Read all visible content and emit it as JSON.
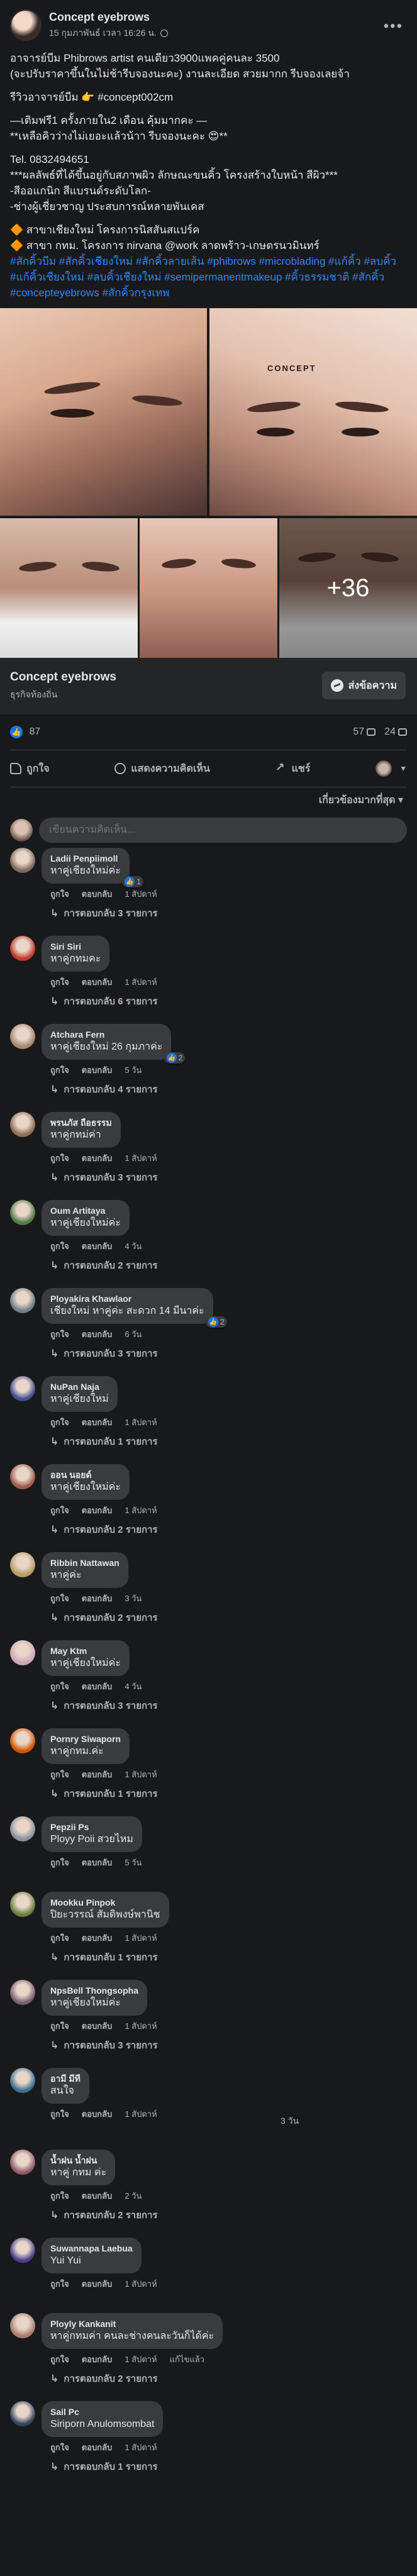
{
  "post": {
    "page_name": "Concept eyebrows",
    "time": "15 กุมภาพันธ์ เวลา 16:26 น.",
    "more": "•••",
    "lines": [
      "อาจารย์บีม Phibrows artist คนเดียว3900แพคคู่คนละ 3500",
      "(จะปรับราคาขึ้นในไม่ช้ารีบจองนะคะ)  งานละเอียด สวยมากก รีบจองเลยจ้า",
      "",
      "รีวิวอาจารย์บีม 👉 #concept002cm",
      "",
      "—เติมฟรี1 ครั้งภายใน2 เดือน คุ้มมากคะ —",
      "**เหลือคิวว่างไม่เยอะแล้วน้าา  รีบจองนะคะ 😍**",
      "",
      "  Tel. 0832494651",
      "***ผลลัพธ์ที่ได้ขึ้นอยู่กับสภาพผิว ลักษณะขนคิ้ว โครงสร้างใบหน้า สีผิว***",
      "-สีออแกนิก สีแบรนด์ระดับโลก-",
      "-ช่างผู้เชี่ยวชาญ ประสบการณ์หลายพันเคส",
      "",
      "🔶 สาขาเชียงใหม่  โครงการนิสสันสแปร์ค",
      "🔶 สาขา กทม.  โครงการ nirvana @work ลาดพร้าว-เกษตรนวมินทร์"
    ],
    "hashtags": "#สักคิ้วบีม #สักคิ้วเชียงใหม่ #สักคิ้วลายเส้น #phibrows #microblading #แก้คิ้ว #ลบคิ้ว #แก้คิ้วเชียงใหม่ #ลบคิ้วเชียงใหม่ #semipermanentmakeup #คิ้วธรรมชาติ #สักคิ้ว #concepteyebrows #สักคิ้วกรุงเทพ",
    "gallery": {
      "watermark": "CONCEPT",
      "more_count": "+36"
    }
  },
  "page_bar": {
    "name": "Concept eyebrows",
    "category": "ธุรกิจท้องถิ่น",
    "message_label": "ส่งข้อความ"
  },
  "reactions": {
    "likes": "87",
    "comments": "57",
    "shares": "24"
  },
  "actions": {
    "like": "ถูกใจ",
    "comment": "แสดงความคิดเห็น",
    "share": "แชร์"
  },
  "sort": {
    "label": "เกี่ยวข้องมากที่สุด ▾"
  },
  "compose": {
    "placeholder": "เขียนความคิดเห็น..."
  },
  "labels": {
    "like": "ถูกใจ",
    "reply": "ตอบกลับ"
  },
  "comments": [
    {
      "name": "Ladii Penpiimoll",
      "text": "หาคู่เชียงใหม่ค่ะ",
      "time": "1 สัปดาห์",
      "replies": "การตอบกลับ 3 รายการ",
      "badge": "1",
      "color": "#7d6a5e"
    },
    {
      "name": "Siri Siri",
      "text": "หาคู่กทมคะ",
      "time": "1 สัปดาห์",
      "replies": "การตอบกลับ 6 รายการ",
      "badge": "",
      "color": "#c0392b"
    },
    {
      "name": "Atchara Fern",
      "text": "หาคู่เชียงใหม่ 26 กุมภาค่ะ",
      "time": "5 วัน",
      "replies": "การตอบกลับ 4 รายการ",
      "badge": "2",
      "color": "#a3876f"
    },
    {
      "name": "พรนภัส ถือธรรม",
      "text": "หาคู่กทม่ค่า",
      "time": "1 สัปดาห์",
      "replies": "การตอบกลับ 3 รายการ",
      "badge": "",
      "color": "#8e6d56"
    },
    {
      "name": "Oum Artitaya",
      "text": "หาคู่เชียงใหม่ค่ะ",
      "time": "4 วัน",
      "replies": "การตอบกลับ 2 รายการ",
      "badge": "",
      "color": "#4f7a45"
    },
    {
      "name": "Ployakira Khawlaor",
      "text": "เชียงใหม่ หาคู่ค่ะ สะดวก 14 มีนาค่ะ",
      "time": "6 วัน",
      "replies": "การตอบกลับ 3 รายการ",
      "badge": "2",
      "color": "#6a7d86"
    },
    {
      "name": "NuPan Naja",
      "text": "หาคู่เชียงใหม่",
      "time": "1 สัปดาห์",
      "replies": "การตอบกลับ 1 รายการ",
      "badge": "",
      "color": "#3f4f8f"
    },
    {
      "name": "ออน  นอยด์",
      "text": "หาคู่เชียงใหม่ค่ะ",
      "time": "1 สัปดาห์",
      "replies": "การตอบกลับ 2 รายการ",
      "badge": "",
      "color": "#9b5a4a"
    },
    {
      "name": "Ribbin Nattawan",
      "text": "หาคู่ค่ะ",
      "time": "3 วัน",
      "replies": "การตอบกลับ 2 รายการ",
      "badge": "",
      "color": "#b59a62"
    },
    {
      "name": "May Ktm",
      "text": "หาคู่เชียงใหม่ค่ะ",
      "time": "4 วัน",
      "replies": "การตอบกลับ 3 รายการ",
      "badge": "",
      "color": "#c9a8b5"
    },
    {
      "name": "Pornry Siwaporn",
      "text": "หาคู่กทม.ค่ะ",
      "time": "1 สัปดาห์",
      "replies": "การตอบกลับ 1 รายการ",
      "badge": "",
      "color": "#d35400"
    },
    {
      "name": "Pepzii Ps",
      "text": "Ployy Poii สวยไหม",
      "time": "5 วัน",
      "replies": "",
      "badge": "",
      "color": "#8a8fa3"
    },
    {
      "name": "Mookku Pinpok",
      "text": "ปิยะวรรณ์ สัมดิพงษ์พานิช",
      "time": "1 สัปดาห์",
      "replies": "การตอบกลับ 1 รายการ",
      "badge": "",
      "color": "#6b7f3c"
    },
    {
      "name": "NpsBell Thongsopha",
      "text": "หาคู่เชียงใหม่ค่ะ",
      "time": "1 สัปดาห์",
      "replies": "การตอบกลับ 3 รายการ",
      "badge": "",
      "color": "#7a5e70"
    },
    {
      "name": "อามี มีที",
      "text": "สนใจ",
      "time": "1 สัปดาห์",
      "replies": "",
      "badge": "",
      "extra": "3 วัน",
      "color": "#3c6e8f"
    },
    {
      "name": "น้ำฝน น้ำฝน",
      "text": "หาคู่ กทม ค่ะ",
      "time": "2 วัน",
      "replies": "การตอบกลับ 2 รายการ",
      "badge": "",
      "color": "#8f5a66"
    },
    {
      "name": "Suwannapa Laebua",
      "text": "Yui Yui",
      "time": "1 สัปดาห์",
      "replies": "",
      "badge": "",
      "color": "#4a3f8c"
    },
    {
      "name": "Ployly Kankanit",
      "text": "หาคู่กทมค่า คนละช่างคนละวันก็ได้ค่ะ",
      "time": "1 สัปดาห์",
      "replies": "การตอบกลับ 2 รายการ",
      "badge": "",
      "edited": "แก้ไขแล้ว",
      "color": "#a87c6c"
    },
    {
      "name": "Sail Pc",
      "text": "Siriporn Anulomsombat",
      "time": "1 สัปดาห์",
      "replies": "การตอบกลับ 1 รายการ",
      "badge": "",
      "color": "#2f4560"
    }
  ]
}
